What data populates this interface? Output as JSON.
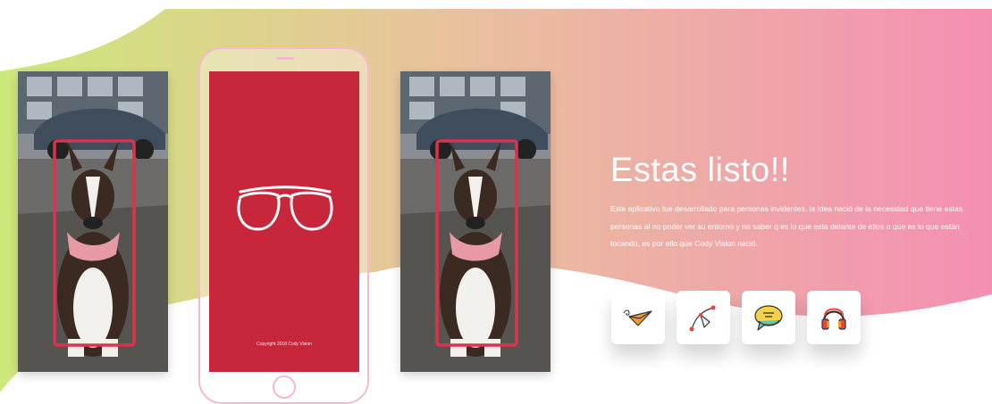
{
  "hero": {
    "title": "Estas listo!!",
    "description": "Este aplicativo fue desarrollado para personas invidentes, la idea nació de la necesidad que tiene estas personas al no poder ver su entorno y no saber q es lo que esta delante de ellos o que es lo que están tocando, es por ello que Cody Vision nació.",
    "colors": {
      "gradient_start": "#cde87a",
      "gradient_end": "#f48fb3",
      "splash_red": "#c8263b",
      "phone_outline": "#f5b9cf"
    }
  },
  "phone": {
    "copyright": "Copyright 2018 Cody Vision",
    "splash_icon": "glasses-icon"
  },
  "photos": [
    {
      "name": "dog-photo-left",
      "detection": "bounding-box"
    },
    {
      "name": "dog-photo-right",
      "detection": "bounding-box"
    }
  ],
  "features": [
    {
      "icon": "paper-plane-icon"
    },
    {
      "icon": "bezier-pen-icon"
    },
    {
      "icon": "speech-bubble-icon"
    },
    {
      "icon": "headphones-icon"
    }
  ]
}
